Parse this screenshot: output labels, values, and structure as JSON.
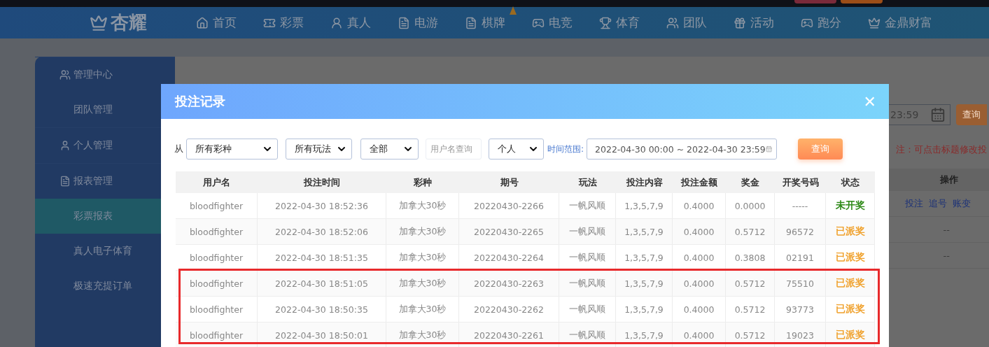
{
  "top_bar": {
    "buttons": [
      {
        "color": "#7a2a3a"
      },
      {
        "color": "#9c4e18"
      }
    ]
  },
  "nav": {
    "logo": "杏耀",
    "items": [
      {
        "label": "首页"
      },
      {
        "label": "彩票"
      },
      {
        "label": "真人"
      },
      {
        "label": "电游"
      },
      {
        "label": "棋牌",
        "badge": true
      },
      {
        "label": "电竞"
      },
      {
        "label": "体育"
      },
      {
        "label": "团队"
      },
      {
        "label": "活动"
      },
      {
        "label": "跑分"
      },
      {
        "label": "金鼎财富"
      }
    ]
  },
  "sidebar": {
    "items": [
      {
        "label": "管理中心",
        "kind": "group",
        "selected": false
      },
      {
        "label": "团队管理",
        "kind": "link",
        "selected": false
      },
      {
        "label": "个人管理",
        "kind": "group",
        "selected": false
      },
      {
        "label": "报表管理",
        "kind": "group",
        "selected": false
      },
      {
        "label": "彩票报表",
        "kind": "link",
        "selected": true
      },
      {
        "label": "真人电子体育",
        "kind": "link",
        "selected": false
      },
      {
        "label": "极速充提订单",
        "kind": "link",
        "selected": false
      }
    ]
  },
  "page": {
    "date_value": "23:59",
    "query_button": "查询",
    "note": "注：可点击标题修改投",
    "table": {
      "header": "操作",
      "rows": [
        {
          "links": [
            "投注",
            "追号",
            "账变"
          ]
        },
        {
          "text": "--"
        },
        {
          "text": "--"
        }
      ]
    }
  },
  "dialog": {
    "title": "投注记录",
    "close": "✕",
    "filters": {
      "from_label": "从",
      "selects": [
        {
          "value": "所有彩种"
        },
        {
          "value": "所有玩法"
        },
        {
          "value": "全部"
        }
      ],
      "username": {
        "placeholder": "用户名查询"
      },
      "scope": {
        "value": "个人"
      },
      "range_label": "时间范围:",
      "range_value": "2022-04-30 00:00 ~ 2022-04-30 23:59",
      "query_button": "查询"
    },
    "table": {
      "columns": [
        "用户名",
        "投注时间",
        "彩种",
        "期号",
        "玩法",
        "投注内容",
        "投注金额",
        "奖金",
        "开奖号码",
        "状态"
      ],
      "rows": [
        {
          "cells": [
            "bloodfighter",
            "2022-04-30 18:52:36",
            "加拿大30秒",
            "20220430-2266",
            "一帆风顺",
            "1,3,5,7,9",
            "0.4000",
            "0.0000",
            "-----",
            "未开奖"
          ],
          "color": "#2e8a18",
          "highlighted": false
        },
        {
          "cells": [
            "bloodfighter",
            "2022-04-30 18:52:06",
            "加拿大30秒",
            "20220430-2265",
            "一帆风顺",
            "1,3,5,7,9",
            "0.4000",
            "0.5712",
            "96572",
            "已派奖"
          ],
          "color": "#f0a22e",
          "highlighted": false
        },
        {
          "cells": [
            "bloodfighter",
            "2022-04-30 18:51:35",
            "加拿大30秒",
            "20220430-2264",
            "一帆风顺",
            "1,3,5,7,9",
            "0.4000",
            "0.3808",
            "02191",
            "已派奖"
          ],
          "color": "#f0a22e",
          "highlighted": false
        },
        {
          "cells": [
            "bloodfighter",
            "2022-04-30 18:51:05",
            "加拿大30秒",
            "20220430-2263",
            "一帆风顺",
            "1,3,5,7,9",
            "0.4000",
            "0.5712",
            "75510",
            "已派奖"
          ],
          "color": "#f0a22e",
          "highlighted": true
        },
        {
          "cells": [
            "bloodfighter",
            "2022-04-30 18:50:35",
            "加拿大30秒",
            "20220430-2262",
            "一帆风顺",
            "1,3,5,7,9",
            "0.4000",
            "0.5712",
            "93773",
            "已派奖"
          ],
          "color": "#f0a22e",
          "highlighted": true
        },
        {
          "cells": [
            "bloodfighter",
            "2022-04-30 18:50:01",
            "加拿大30秒",
            "20220430-2261",
            "一帆风顺",
            "1,3,5,7,9",
            "0.4000",
            "0.5712",
            "19023",
            "已派奖"
          ],
          "color": "#f0a22e",
          "highlighted": true
        }
      ]
    }
  }
}
